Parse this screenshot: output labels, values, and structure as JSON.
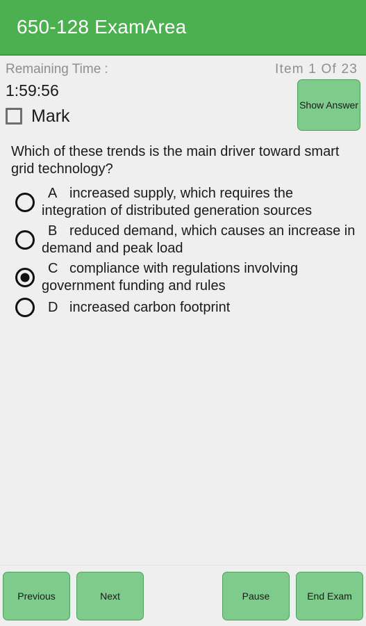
{
  "app": {
    "title": "650-128 ExamArea",
    "header_color": "#4CAF50",
    "background_color": "#EFEFEF",
    "button_color": "#7ECB8B"
  },
  "status": {
    "remaining_time_label": "Remaining Time :",
    "item_counter": "Item 1 Of 23",
    "timer_value": "1:59:56"
  },
  "controls": {
    "mark_label": "Mark",
    "mark_checked": false,
    "show_answer_label": "Show Answer"
  },
  "question": {
    "text": "Which of these trends is the main driver toward smart grid technology?",
    "options": [
      {
        "letter": "A",
        "text": "increased supply, which requires the integration of distributed generation sources",
        "selected": false
      },
      {
        "letter": "B",
        "text": "reduced demand, which causes an increase in demand and peak load",
        "selected": false
      },
      {
        "letter": "C",
        "text": "compliance with regulations involving government funding and rules",
        "selected": true
      },
      {
        "letter": "D",
        "text": "increased carbon footprint",
        "selected": false
      }
    ]
  },
  "bottom_bar": {
    "previous_label": "Previous",
    "next_label": "Next",
    "pause_label": "Pause",
    "end_exam_label": "End Exam"
  }
}
